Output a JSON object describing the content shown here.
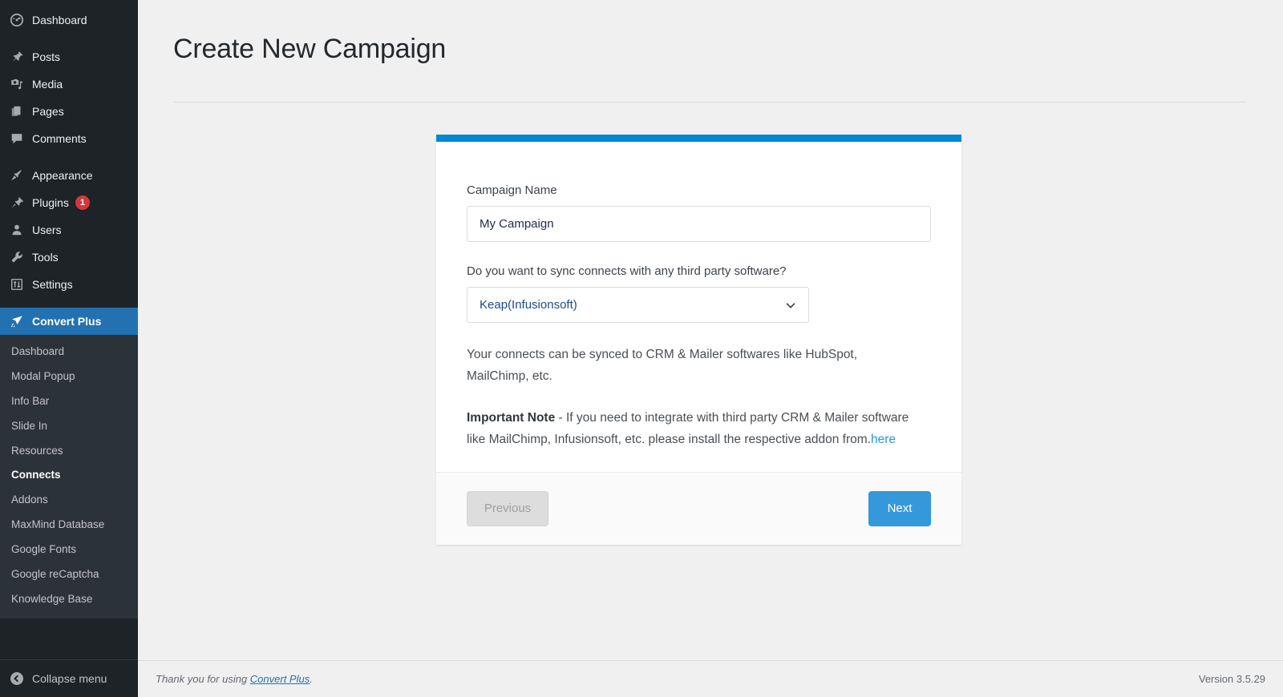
{
  "sidebar": {
    "items": [
      {
        "label": "Dashboard",
        "icon": "dashboard-icon",
        "name": "dashboard"
      },
      {
        "label": "Posts",
        "icon": "pin-icon",
        "name": "posts"
      },
      {
        "label": "Media",
        "icon": "media-icon",
        "name": "media"
      },
      {
        "label": "Pages",
        "icon": "pages-icon",
        "name": "pages"
      },
      {
        "label": "Comments",
        "icon": "comment-icon",
        "name": "comments"
      },
      {
        "label": "Appearance",
        "icon": "brush-icon",
        "name": "appearance"
      },
      {
        "label": "Plugins",
        "icon": "plug-icon",
        "name": "plugins",
        "badge": "1"
      },
      {
        "label": "Users",
        "icon": "user-icon",
        "name": "users"
      },
      {
        "label": "Tools",
        "icon": "wrench-icon",
        "name": "tools"
      },
      {
        "label": "Settings",
        "icon": "sliders-icon",
        "name": "settings"
      },
      {
        "label": "Convert Plus",
        "icon": "convert-plus-icon",
        "name": "convert-plus",
        "active": true
      }
    ],
    "submenu": [
      {
        "label": "Dashboard",
        "name": "dashboard"
      },
      {
        "label": "Modal Popup",
        "name": "modal-popup"
      },
      {
        "label": "Info Bar",
        "name": "info-bar"
      },
      {
        "label": "Slide In",
        "name": "slide-in"
      },
      {
        "label": "Resources",
        "name": "resources"
      },
      {
        "label": "Connects",
        "name": "connects",
        "current": true
      },
      {
        "label": "Addons",
        "name": "addons"
      },
      {
        "label": "MaxMind Database",
        "name": "maxmind-database"
      },
      {
        "label": "Google Fonts",
        "name": "google-fonts"
      },
      {
        "label": "Google reCaptcha",
        "name": "google-recaptcha"
      },
      {
        "label": "Knowledge Base",
        "name": "knowledge-base"
      }
    ],
    "collapse_label": "Collapse menu",
    "active_color": "#2271b1",
    "badge_color": "#d63638",
    "bg_color": "#1d2327",
    "submenu_bg_color": "#2c3338"
  },
  "page": {
    "title": "Create New Campaign"
  },
  "card": {
    "accent_color": "#0089d0",
    "campaign_name_label": "Campaign Name",
    "campaign_name_value": "My Campaign",
    "campaign_name_placeholder": "My Campaign",
    "sync_question": "Do you want to sync connects with any third party software?",
    "sync_selected": "Keap(Infusionsoft)",
    "help_text": "Your connects can be synced to CRM & Mailer softwares like HubSpot, MailChimp, etc.",
    "note_strong": "Important Note",
    "note_body": " - If you need to integrate with third party CRM & Mailer software like MailChimp, Infusionsoft, etc. please install the respective addon from.",
    "note_link": "here",
    "note_link_color": "#2196f3",
    "previous_label": "Previous",
    "next_label": "Next",
    "next_color": "#3498db",
    "previous_disabled": true
  },
  "footer": {
    "thanks_prefix": "Thank you for using ",
    "thanks_link": "Convert Plus",
    "thanks_suffix": ".",
    "version": "Version 3.5.29"
  }
}
